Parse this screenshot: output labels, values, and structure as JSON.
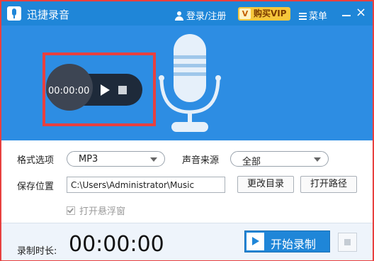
{
  "titlebar": {
    "app_title": "迅捷录音",
    "login_label": "登录/注册",
    "vip_label": "购买VIP",
    "vip_badge": "V",
    "menu_label": "菜单",
    "close_symbol": "×"
  },
  "player": {
    "time": "00:00:00"
  },
  "settings": {
    "format_label": "格式选项",
    "format_value": "MP3",
    "source_label": "声音来源",
    "source_value": "全部",
    "save_label": "保存位置",
    "save_path": "C:\\Users\\Administrator\\Music",
    "change_dir_label": "更改目录",
    "open_path_label": "打开路径",
    "float_window_label": "打开悬浮窗",
    "float_window_checked": true
  },
  "footer": {
    "duration_label": "录制时长:",
    "duration_value": "00:00:00",
    "start_label": "开始录制"
  },
  "colors": {
    "accent": "#1f86d8",
    "highlight_border": "#e8403f",
    "vip": "#f6c63b"
  },
  "icons": [
    "app-logo-icon",
    "user-icon",
    "vip-icon",
    "menu-icon",
    "minimize-icon",
    "close-icon",
    "play-icon",
    "stop-icon",
    "microphone-icon",
    "dropdown-caret-icon",
    "checkbox-icon"
  ]
}
